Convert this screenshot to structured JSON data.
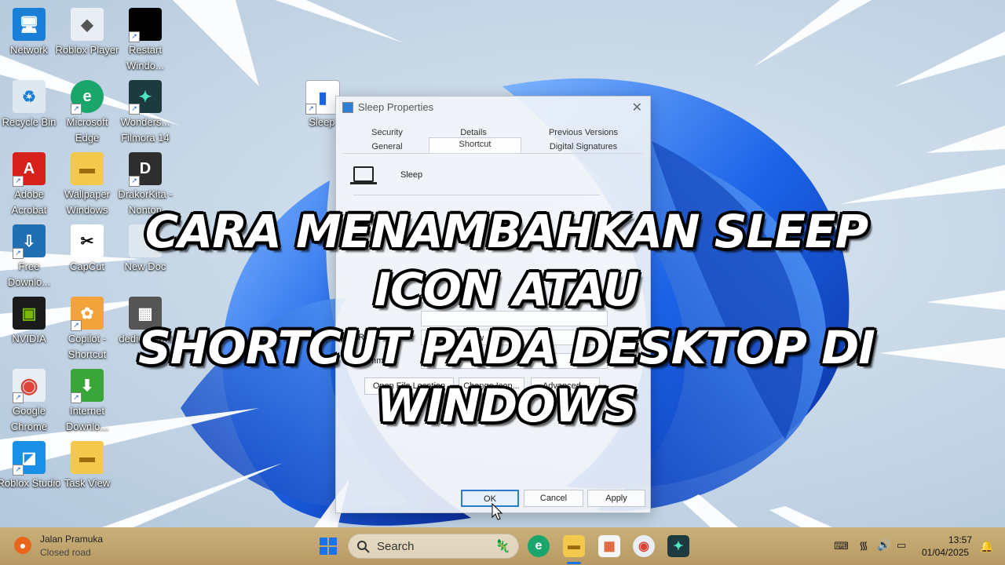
{
  "desktop": {
    "icons": [
      {
        "label": "Network",
        "color": "#1a7fd6",
        "glyph": "🖥"
      },
      {
        "label": "Roblox Player",
        "color": "#e8eef4",
        "glyph": "◆"
      },
      {
        "label": "Restart Windo...",
        "color": "#000000",
        "glyph": ""
      },
      {
        "label": "Recycle Bin",
        "color": "#dfe8ef",
        "glyph": "♻"
      },
      {
        "label": "Microsoft Edge",
        "color": "#1aa56a",
        "glyph": "e"
      },
      {
        "label": "Wonders... Filmora 14",
        "color": "#1d3b3f",
        "glyph": "✦"
      },
      {
        "label": "Adobe Acrobat",
        "color": "#d6201c",
        "glyph": "A"
      },
      {
        "label": "Wallpaper Windows",
        "color": "#f2c94c",
        "glyph": "▬"
      },
      {
        "label": "DrakorKita - Nonton",
        "color": "#2e2e2e",
        "glyph": "D"
      },
      {
        "label": "Free Downlo...",
        "color": "#1f6fb2",
        "glyph": "⇩"
      },
      {
        "label": "CapCut",
        "color": "#ffffff",
        "glyph": "✂"
      },
      {
        "label": "New Doc",
        "color": "#dfe8ef",
        "glyph": ""
      },
      {
        "label": "NVIDIA",
        "color": "#1b1b1b",
        "glyph": "▣"
      },
      {
        "label": "Copilot - Shortcut",
        "color": "#f2a33a",
        "glyph": "✿"
      },
      {
        "label": "dedicated...",
        "color": "#555555",
        "glyph": "▦"
      },
      {
        "label": "Google Chrome",
        "color": "#e8eef4",
        "glyph": "◉"
      },
      {
        "label": "Internet Downlo...",
        "color": "#3aa63a",
        "glyph": "⬇"
      },
      {
        "label": "Roblox Studio",
        "color": "#1a8fe6",
        "glyph": "◪"
      },
      {
        "label": "Task View",
        "color": "#f2c94c",
        "glyph": "▬"
      },
      {
        "label": "Sleep",
        "color": "#ffffff",
        "glyph": "▮"
      }
    ]
  },
  "dialog": {
    "title": "Sleep Properties",
    "close_label": "✕",
    "tabs_top": [
      "Security",
      "Details",
      "Previous Versions"
    ],
    "tabs_bottom": [
      "General",
      "Shortcut",
      "Digital Signatures"
    ],
    "active_tab": "Shortcut",
    "shortcut_name": "Sleep",
    "run_label": "Run:",
    "run_value": "Normal window",
    "comment_label": "Comment:",
    "comment_value": "",
    "buttons": {
      "open_file_location": "Open File Location",
      "change_icon": "Change Icon...",
      "advanced": "Advanced..."
    },
    "footer": {
      "ok": "OK",
      "cancel": "Cancel",
      "apply": "Apply"
    }
  },
  "headline": {
    "line1": "CARA MENAMBAHKAN SLEEP ICON ATAU",
    "line2": "SHORTCUT PADA DESKTOP DI WINDOWS"
  },
  "taskbar": {
    "weather_title": "Jalan Pramuka",
    "weather_subtitle": "Closed road",
    "search_placeholder": "Search",
    "time": "13:57",
    "date": "01/04/2025"
  }
}
